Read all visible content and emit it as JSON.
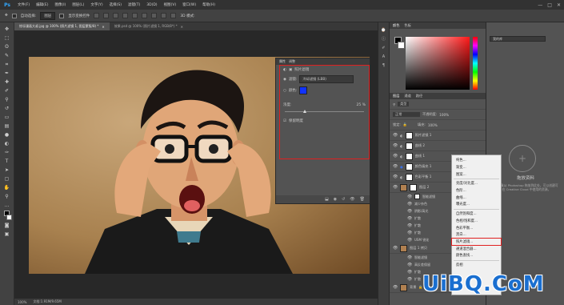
{
  "app": {
    "logo": "Ps"
  },
  "menu": [
    "文件(F)",
    "编辑(E)",
    "图像(I)",
    "图层(L)",
    "文字(Y)",
    "选择(S)",
    "滤镜(T)",
    "3D(D)",
    "视图(V)",
    "窗口(W)",
    "帮助(H)"
  ],
  "window_controls": [
    "—",
    "□",
    "✕"
  ],
  "options": {
    "auto_select": "自动选择:",
    "auto_select_value": "图层",
    "show_transform": "显示变换控件",
    "mode_3d": "3D 模式:"
  },
  "doc_tabs": [
    {
      "label": "惊讶漫画大叔.jpg @ 100% (照片滤镜 1, 图层蒙版/8) *",
      "active": true
    },
    {
      "label": "效果.psd @ 100% (照片滤镜 1, RGB/8*) *",
      "active": false
    }
  ],
  "statusbar": {
    "zoom": "100%",
    "doc": "文档:1.91M/9.65M"
  },
  "properties": {
    "tabs": [
      "属性",
      "调整"
    ],
    "title": "照片滤镜",
    "filter_label": "滤镜:",
    "filter_value": "冷却滤镜 (LBB)",
    "color_label": "颜色:",
    "density_label": "浓度:",
    "density_value": "25",
    "density_unit": "%",
    "density": 0.25,
    "preserve_label": "保留明度",
    "filter_color": "#1133ff"
  },
  "color_panel": {
    "tabs": [
      "颜色",
      "色板"
    ]
  },
  "layers_panel": {
    "tabs": [
      "图层",
      "通道",
      "路径"
    ],
    "search": "类型",
    "blend": "正常",
    "opacity_label": "不透明度:",
    "opacity": "100%",
    "lock_label": "锁定:",
    "fill_label": "填充:",
    "fill": "100%",
    "rows": [
      {
        "name": "照片滤镜 1",
        "kind": "adj"
      },
      {
        "name": "曲线 2",
        "kind": "adj"
      },
      {
        "name": "曲线 1",
        "kind": "adj"
      },
      {
        "name": "颜色填充 1",
        "kind": "fill"
      },
      {
        "name": "色彩平衡 1",
        "kind": "adj"
      }
    ],
    "group": {
      "name": "图层 2",
      "sub": "智能滤镜"
    },
    "filters": [
      "减少杂色",
      "阴影/高光",
      "扩散",
      "扩散",
      "扩散",
      "USM 锐化"
    ],
    "group2": {
      "name": "图层 1 拷贝",
      "sub": "智能滤镜"
    },
    "filters2": [
      "高反差保留",
      "扩散",
      "扩散"
    ],
    "bottom": {
      "name": "背景"
    }
  },
  "context_menu": {
    "items": [
      "纯色...",
      "渐变...",
      "图案...",
      "亮度/对比度...",
      "色阶...",
      "曲线...",
      "曝光度...",
      "自然饱和度...",
      "色相/饱和度...",
      "色彩平衡...",
      "黑白...",
      "照片滤镜...",
      "通道混合器...",
      "颜色查找...",
      "反相"
    ],
    "highlighted_index": 11
  },
  "libraries": {
    "dropdown": "我的库",
    "title": "拖放资料",
    "desc": "将对象从 Photoshop 拖放到此处，可以创建可在 Creative Cloud 中使用的资源。"
  },
  "watermark": "UiBQ.CoM"
}
